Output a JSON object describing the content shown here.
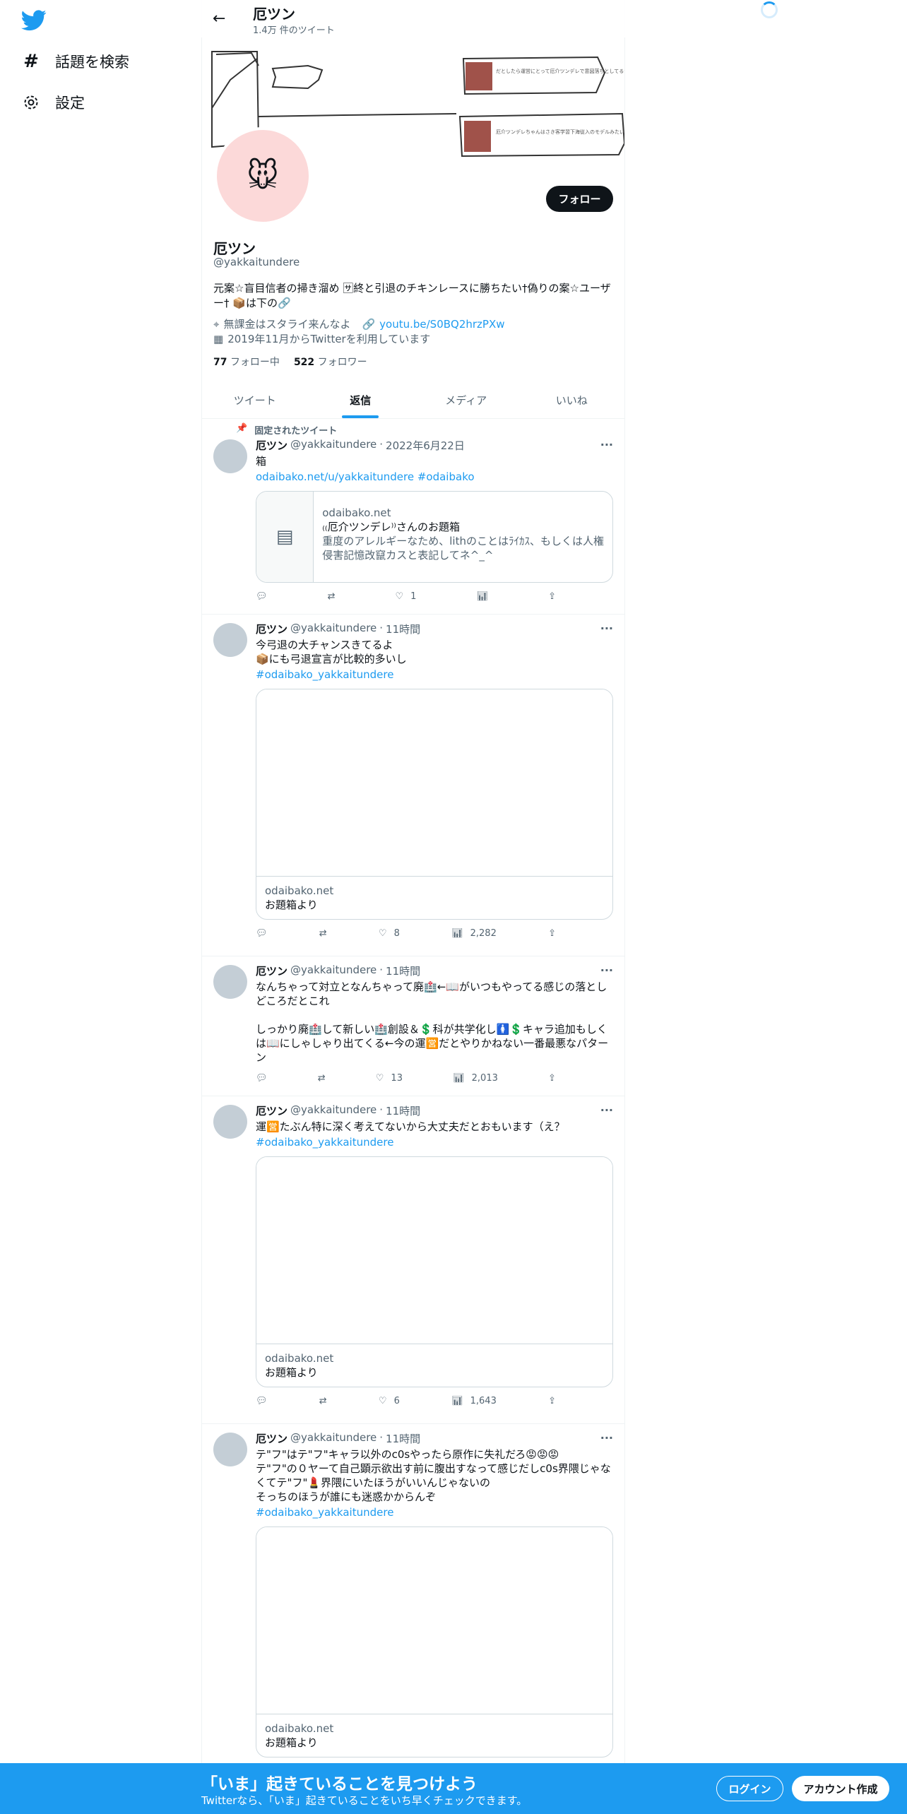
{
  "sidebar": {
    "items": [
      {
        "label": "話題を検索",
        "icon": "hashtag-icon"
      },
      {
        "label": "設定",
        "icon": "gear-icon"
      }
    ]
  },
  "header": {
    "name": "厄ツン",
    "tweet_count": "1.4万 件のツイート"
  },
  "profile": {
    "name": "厄ツン",
    "handle": "@yakkaitundere",
    "bio": "元案☆盲目信者の掃き溜め 🈂終と引退のチキンレースに勝ちたい†偽りの案☆ユーザー† 📦は下の🔗",
    "location": "無課金はスタライ来んなよ",
    "link": "youtu.be/S0BQ2hrzPXw",
    "joined": "2019年11月からTwitterを利用しています",
    "following_count": "77",
    "following_label": "フォロー中",
    "followers_count": "522",
    "followers_label": "フォロワー",
    "follow_button": "フォロー",
    "banner_text_1": "だとしたら運営にとって厄介ツンデレで意図落ちとしてるから運営に嫌はないか一笑",
    "banner_text_2": "厄介ツンデレちゃんはさき客学習下海従入のモデルみたいな場合がなんだろうね"
  },
  "tabs": [
    "ツイート",
    "返信",
    "メディア",
    "いいね"
  ],
  "pinned_label": "固定されたツイート",
  "tweets": [
    {
      "name": "厄ツン",
      "handle": "@yakkaitundere",
      "time": "2022年6月22日",
      "text": "箱",
      "link_text": "odaibako.net/u/yakkaitundere #odaibako",
      "card_domain": "odaibako.net",
      "card_title": "₍₍厄介ツンデレ⁾⁾さんのお題箱",
      "card_desc": "重度のアレルギーなため、lithのことはﾗｲｶｽ、もしくは人権侵害記憶改竄カスと表記してネ^_^",
      "replies": "",
      "retweets": "",
      "likes": "1",
      "views": ""
    },
    {
      "name": "厄ツン",
      "handle": "@yakkaitundere",
      "time": "11時間",
      "text": "今弓退の大チャンスきてるよ\n📦にも弓退宣言が比較的多いし",
      "link_text": "#odaibako_yakkaitundere",
      "card_domain": "odaibako.net",
      "card_title": "お題箱より",
      "likes": "8",
      "views": "2,282"
    },
    {
      "name": "厄ツン",
      "handle": "@yakkaitundere",
      "time": "11時間",
      "text": "なんちゃって対立となんちゃって廃🏥←📖がいつもやってる感じの落としどころだとこれ\n\nしっかり廃🏥して新しい🏥創設＆💲科が共学化し🚺💲キャラ追加もしくは📖にしゃしゃり出てくる←今の運🈺だとやりかねない一番最悪なパターン",
      "likes": "13",
      "views": "2,013"
    },
    {
      "name": "厄ツン",
      "handle": "@yakkaitundere",
      "time": "11時間",
      "text": "運🈺たぶん特に深く考えてないから大丈夫だとおもいます（え？",
      "link_text": "#odaibako_yakkaitundere",
      "card_domain": "odaibako.net",
      "card_title": "お題箱より",
      "likes": "6",
      "views": "1,643"
    },
    {
      "name": "厄ツン",
      "handle": "@yakkaitundere",
      "time": "11時間",
      "text": "テ\"フ\"はテ\"フ\"キャラ以外のc0sやったら原作に失礼だろ😡😡😡\nテ\"フ\"の０ヤーて自己顕示欲出す前に腹出すなって感じだしc0s界隈じゃなくてテ\"フ\"💄界隈にいたほうがいいんじゃないの\nそっちのほうが誰にも迷惑かからんぞ",
      "link_text": "#odaibako_yakkaitundere",
      "card_domain": "odaibako.net",
      "card_title": "お題箱より"
    }
  ],
  "bottom_bar": {
    "title": "「いま」起きていることを見つけよう",
    "subtitle": "Twitterなら、「いま」起きていることをいち早くチェックできます。",
    "login": "ログイン",
    "signup": "アカウント作成"
  },
  "colors": {
    "accent": "#1d9bf0",
    "text": "#0f1419",
    "secondary": "#536471"
  }
}
